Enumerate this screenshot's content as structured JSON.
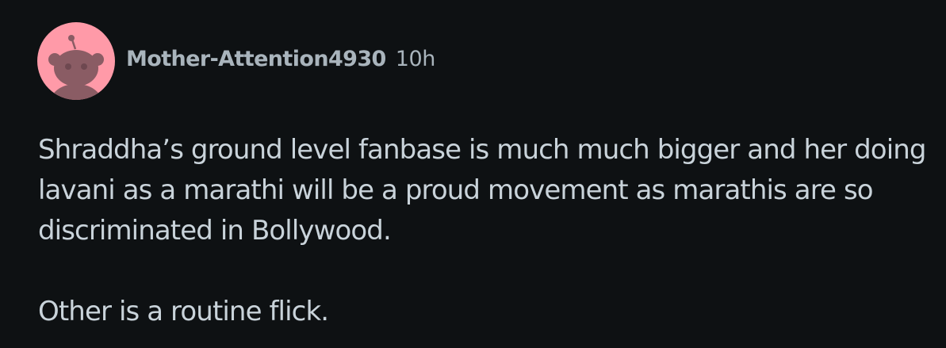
{
  "comment": {
    "author": "Mother-Attention4930",
    "timestamp": "10h",
    "avatar_icon": "snoo-avatar-icon",
    "avatar_color": "#ff9aa8",
    "paragraphs": [
      "Shraddha’s ground level fanbase is much much bigger and her doing lavani as a marathi will be a proud movement as marathis are so discriminated in Bollywood.",
      "Other is a routine flick."
    ]
  },
  "colors": {
    "background": "#0e1113",
    "meta_text": "#a9b4bc",
    "body_text": "#c9d3da"
  }
}
